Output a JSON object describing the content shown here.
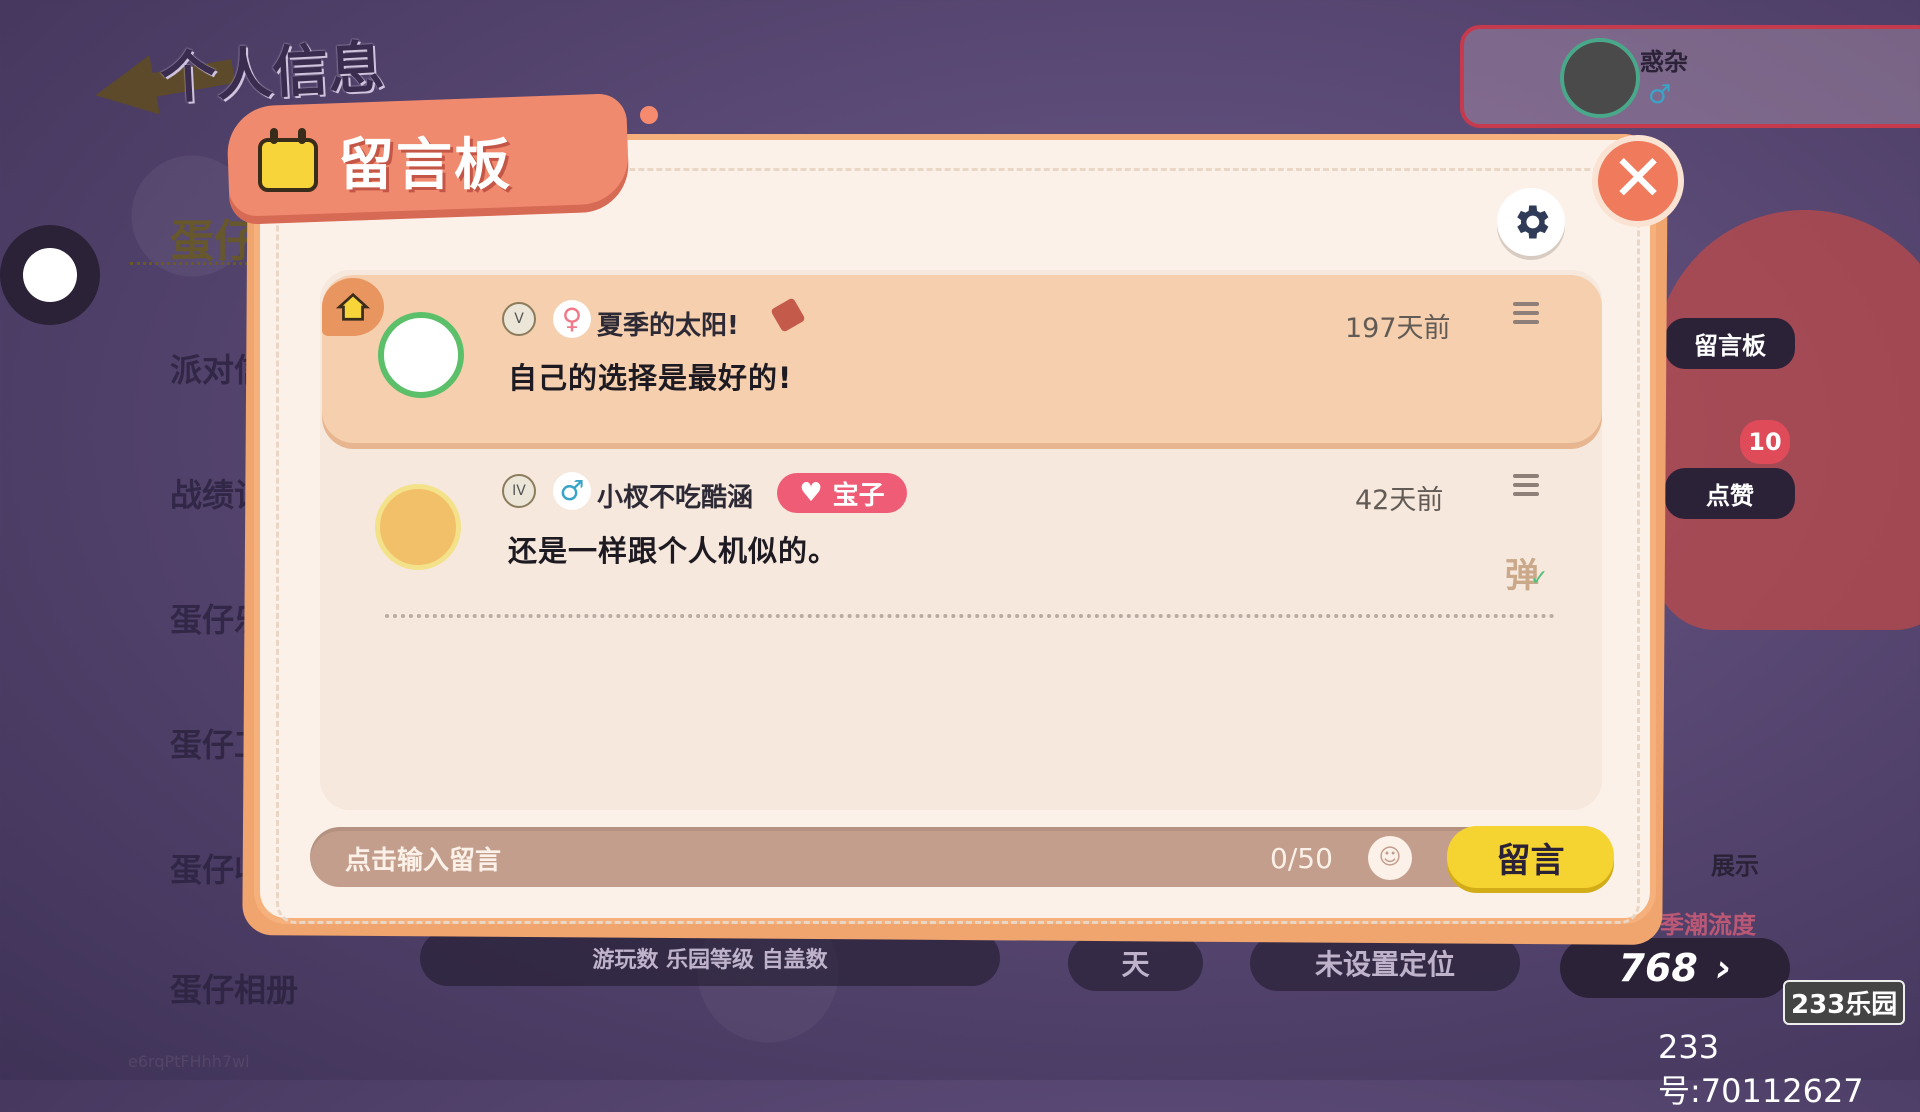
{
  "background": {
    "page_title": "个人信息",
    "menu": {
      "active_item": "蛋仔信",
      "items": [
        "派对信",
        "战绩记",
        "蛋仔乐",
        "蛋仔工",
        "蛋仔收",
        "蛋仔相册"
      ]
    },
    "profile": {
      "name": "惑杂",
      "gender": "♂"
    },
    "side_buttons": {
      "board": "留言板",
      "like": "点赞",
      "like_count": "10",
      "show": "展示"
    },
    "bottom": {
      "chip1": "天",
      "chip2": "未设置定位",
      "trend_label": "季潮流度",
      "score": "768"
    },
    "stats_labels": "游玩数 乐园等级 自盖数",
    "tiny_code": "e6rqPtFHhh7wl"
  },
  "modal": {
    "title": "留言板",
    "close_label": "✕",
    "messages": [
      {
        "username": "夏季的太阳!",
        "gender": "♀",
        "level_badge": "V",
        "time": "197天前",
        "text": "自己的选择是最好的!",
        "pinned": true
      },
      {
        "username": "小杈不吃酷涵",
        "gender": "♂",
        "level_badge": "IV",
        "time": "42天前",
        "text": "还是一样跟个人机似的。",
        "tag": "宝子",
        "danmaku_label": "弹",
        "danmaku_check": "✓"
      }
    ],
    "input": {
      "placeholder": "点击输入留言",
      "counter": "0/50",
      "send_label": "留言"
    }
  },
  "watermark": {
    "logo": "233乐园",
    "id": "233号:70112627"
  },
  "colors": {
    "accent_orange": "#f08a6e",
    "card_bg": "#f5cfae",
    "send_yellow": "#f5d330",
    "tag_pink": "#ef5c76"
  }
}
